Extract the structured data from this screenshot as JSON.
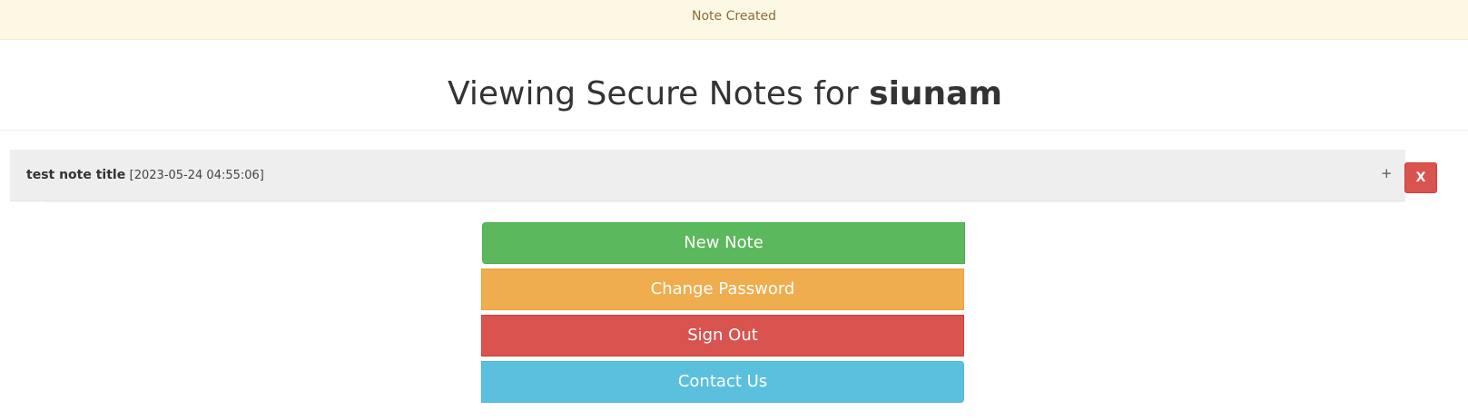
{
  "banner": {
    "message": "Note Created"
  },
  "header": {
    "title_prefix": "Viewing Secure Notes for",
    "username": "siunam"
  },
  "notes": [
    {
      "title": "test note title",
      "timestamp": "[2023-05-24 04:55:06]",
      "expand_label": "+",
      "delete_label": "X"
    }
  ],
  "actions": {
    "new_note": "New Note",
    "change_password": "Change Password",
    "sign_out": "Sign Out",
    "contact_us": "Contact Us"
  },
  "colors": {
    "banner_bg": "#fcf8e3",
    "banner_text": "#8a6d3b",
    "success": "#5cb85c",
    "warning": "#f0ad4e",
    "danger": "#d9534f",
    "info": "#5bc0de"
  },
  "icons": {
    "expand": "plus-icon"
  }
}
